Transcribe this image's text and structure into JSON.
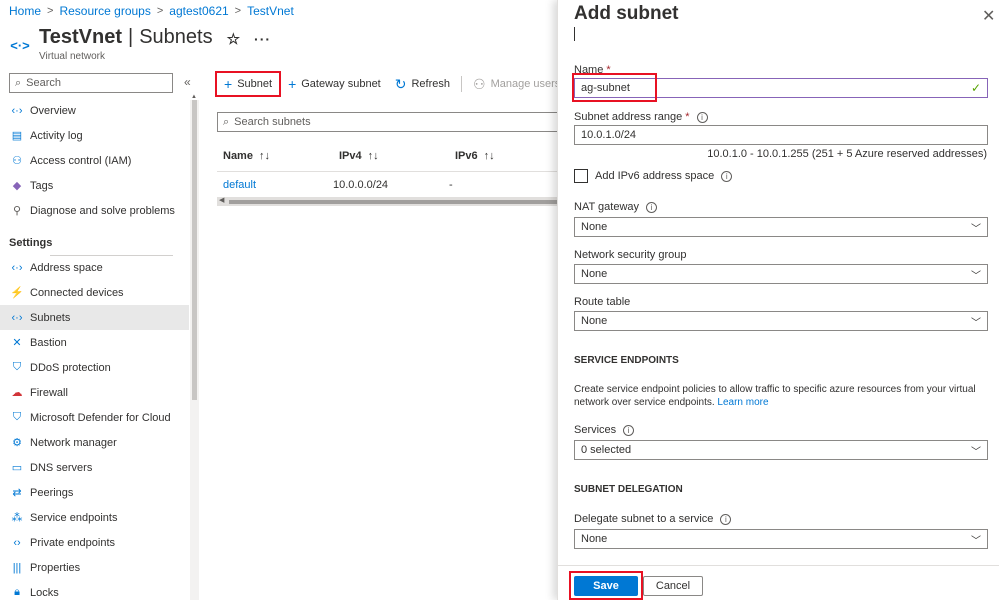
{
  "breadcrumb": [
    "Home",
    "Resource groups",
    "agtest0621",
    "TestVnet"
  ],
  "header": {
    "title": "TestVnet",
    "section": "Subnets",
    "subtitle": "Virtual network"
  },
  "left_search": {
    "placeholder": "Search"
  },
  "nav": {
    "top_items": [
      {
        "label": "Overview",
        "icon": "vnet-icon"
      },
      {
        "label": "Activity log",
        "icon": "log-icon"
      },
      {
        "label": "Access control (IAM)",
        "icon": "iam-icon"
      },
      {
        "label": "Tags",
        "icon": "tag-icon"
      },
      {
        "label": "Diagnose and solve problems",
        "icon": "wrench-icon"
      }
    ],
    "settings_label": "Settings",
    "settings_items": [
      {
        "label": "Address space",
        "icon": "vnet-icon"
      },
      {
        "label": "Connected devices",
        "icon": "plug-icon"
      },
      {
        "label": "Subnets",
        "icon": "vnet-icon"
      },
      {
        "label": "Bastion",
        "icon": "bastion-icon"
      },
      {
        "label": "DDoS protection",
        "icon": "shield-icon"
      },
      {
        "label": "Firewall",
        "icon": "firewall-icon"
      },
      {
        "label": "Microsoft Defender for Cloud",
        "icon": "defender-icon"
      },
      {
        "label": "Network manager",
        "icon": "network-manager-icon"
      },
      {
        "label": "DNS servers",
        "icon": "dns-icon"
      },
      {
        "label": "Peerings",
        "icon": "peering-icon"
      },
      {
        "label": "Service endpoints",
        "icon": "service-endpoint-icon"
      },
      {
        "label": "Private endpoints",
        "icon": "private-endpoint-icon"
      },
      {
        "label": "Properties",
        "icon": "properties-icon"
      },
      {
        "label": "Locks",
        "icon": "lock-icon"
      }
    ]
  },
  "toolbar": {
    "subnet": "Subnet",
    "gateway_subnet": "Gateway subnet",
    "refresh": "Refresh",
    "manage_users": "Manage users"
  },
  "main": {
    "search_placeholder": "Search subnets",
    "columns": [
      "Name",
      "IPv4",
      "IPv6"
    ],
    "rows": [
      {
        "name": "default",
        "ipv4": "10.0.0.0/24",
        "ipv6": "-"
      }
    ]
  },
  "blade": {
    "title": "Add subnet",
    "name_label": "Name",
    "name_value": "ag-subnet",
    "address_range_label": "Subnet address range",
    "address_range_value": "10.0.1.0/24",
    "address_range_hint": "10.0.1.0 - 10.0.1.255 (251 + 5 Azure reserved addresses)",
    "ipv6_label": "Add IPv6 address space",
    "nat_label": "NAT gateway",
    "nat_value": "None",
    "nsg_label": "Network security group",
    "nsg_value": "None",
    "route_label": "Route table",
    "route_value": "None",
    "service_endpoints_title": "SERVICE ENDPOINTS",
    "service_endpoints_desc": "Create service endpoint policies to allow traffic to specific azure resources from your virtual network over service endpoints.",
    "learn_more": "Learn more",
    "services_label": "Services",
    "services_value": "0 selected",
    "delegation_title": "SUBNET DELEGATION",
    "delegate_label": "Delegate subnet to a service",
    "delegate_value": "None",
    "save": "Save",
    "cancel": "Cancel"
  },
  "colors": {
    "accent": "#0078d4",
    "highlight": "#e81123"
  }
}
